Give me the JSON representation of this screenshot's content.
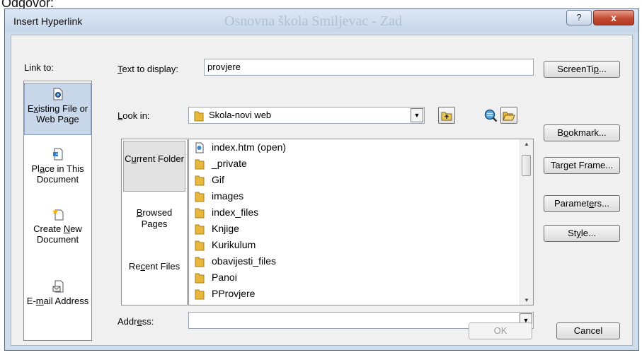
{
  "page": {
    "top_text": "Odgovor:"
  },
  "window": {
    "title": "Insert Hyperlink",
    "background_title": "Osnovna škola Smiljevac - Zad",
    "help_label": "?",
    "close_label": "x"
  },
  "link_to": {
    "label": "Link to:",
    "items": [
      {
        "pre": "E",
        "u": "x",
        "post": "isting File or Web Page",
        "icon": "existing-file-icon",
        "selected": true
      },
      {
        "pre": "Pl",
        "u": "a",
        "post": "ce in This Document",
        "icon": "place-document-icon",
        "selected": false
      },
      {
        "pre": "Create ",
        "u": "N",
        "post": "ew Document",
        "icon": "new-document-icon",
        "selected": false
      },
      {
        "pre": "E-",
        "u": "m",
        "post": "ail Address",
        "icon": "email-icon",
        "selected": false
      }
    ]
  },
  "text_to_display": {
    "pre": "",
    "u": "T",
    "post": "ext to display:",
    "value": "provjere"
  },
  "look_in": {
    "pre": "",
    "u": "L",
    "post": "ook in:",
    "value": "Skola-novi web"
  },
  "bar": {
    "current": {
      "pre": "C",
      "u": "u",
      "post": "rrent Folder"
    },
    "browsed": {
      "pre": "",
      "u": "B",
      "post": "rowsed Pages"
    },
    "recent": {
      "pre": "Re",
      "u": "c",
      "post": "ent Files"
    }
  },
  "files": [
    {
      "name": "index.htm (open)",
      "icon": "html-file-icon"
    },
    {
      "name": "_private",
      "icon": "folder-icon"
    },
    {
      "name": "Gif",
      "icon": "folder-icon"
    },
    {
      "name": "images",
      "icon": "folder-icon"
    },
    {
      "name": "index_files",
      "icon": "folder-icon"
    },
    {
      "name": "Knjige",
      "icon": "folder-icon"
    },
    {
      "name": "Kurikulum",
      "icon": "folder-icon"
    },
    {
      "name": "obavijesti_files",
      "icon": "folder-icon"
    },
    {
      "name": "Panoi",
      "icon": "folder-icon"
    },
    {
      "name": "PProvjere",
      "icon": "folder-icon"
    }
  ],
  "address": {
    "pre": "Addr",
    "u": "e",
    "post": "ss:",
    "value": ""
  },
  "buttons": {
    "screentip": {
      "pre": "ScreenTi",
      "u": "p",
      "post": "..."
    },
    "bookmark": {
      "pre": "B",
      "u": "o",
      "post": "okmark..."
    },
    "target_frame": {
      "pre": "Tar",
      "u": "g",
      "post": "et Frame..."
    },
    "parameters": {
      "pre": "Paramet",
      "u": "e",
      "post": "rs..."
    },
    "style": {
      "pre": "St",
      "u": "y",
      "post": "le..."
    },
    "ok": "OK",
    "cancel": "Cancel"
  },
  "colors": {
    "folder": "#e8b83c",
    "selected_bg": "#c8d8ea",
    "close": "#c24a32"
  }
}
